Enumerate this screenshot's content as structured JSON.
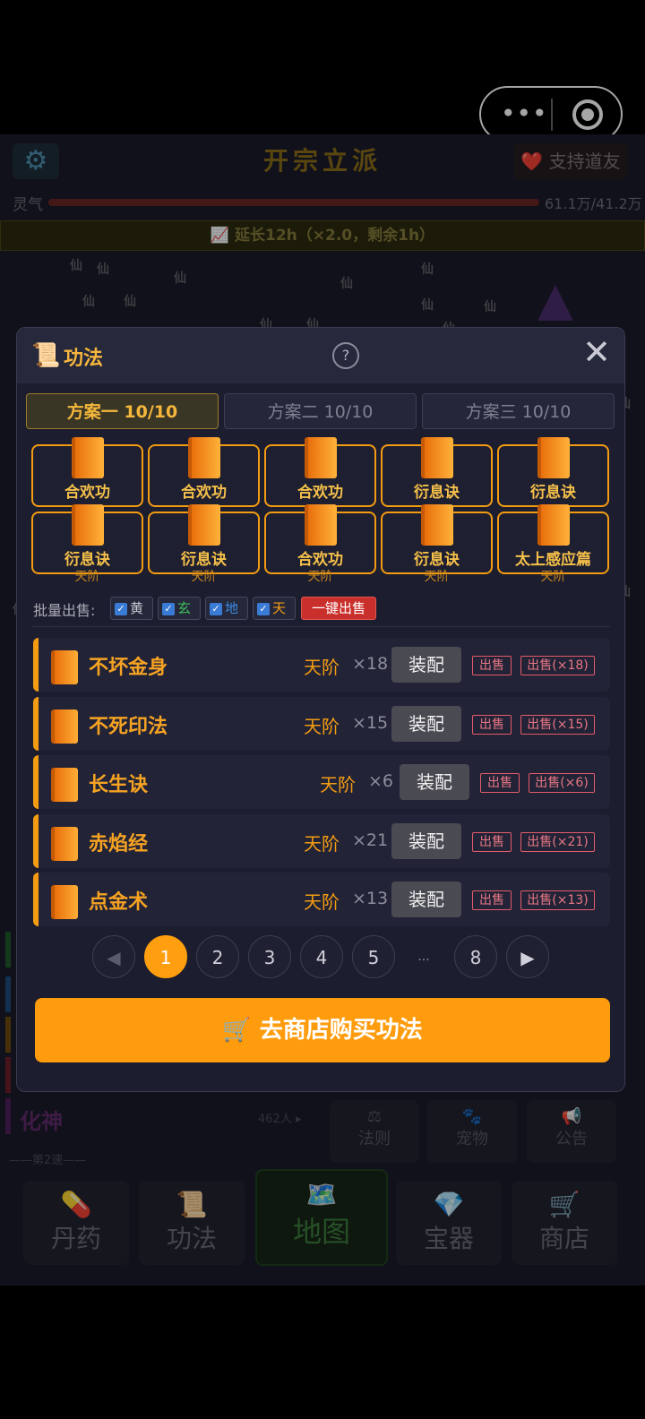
{
  "capsule": {
    "menu_icon": "more-dots-icon",
    "target_icon": "target-icon"
  },
  "game_header": {
    "settings_icon": "gear-icon",
    "title": "开宗立派",
    "support_label": "❤️ 支持道友",
    "qi_label": "灵气",
    "qi_value": "61.1万/41.2万",
    "extend_text": "📈 延长12h（×2.0，剩余1h）"
  },
  "background": {
    "xian_glyph": "仙",
    "huashen_label": "化神",
    "huashen_count": "462人 ▸",
    "second_label": "——第2速——",
    "side_buttons": [
      {
        "icon": "⚖",
        "label": "法则"
      },
      {
        "icon": "🐾",
        "label": "宠物"
      },
      {
        "icon": "📢",
        "label": "公告"
      }
    ],
    "bottom_nav": [
      {
        "icon": "💊",
        "label": "丹药"
      },
      {
        "icon": "📜",
        "label": "功法"
      },
      {
        "icon": "🗺️",
        "label": "地图"
      },
      {
        "icon": "💎",
        "label": "宝器"
      },
      {
        "icon": "🛒",
        "label": "商店"
      }
    ]
  },
  "modal": {
    "title_icon": "📜",
    "title": "功法",
    "help_label": "?",
    "close_label": "✕",
    "tabs": [
      {
        "label": "方案一 10/10",
        "active": true
      },
      {
        "label": "方案二 10/10",
        "active": false
      },
      {
        "label": "方案三 10/10",
        "active": false
      }
    ],
    "slots": [
      {
        "name": "合欢功",
        "grade": ""
      },
      {
        "name": "合欢功",
        "grade": ""
      },
      {
        "name": "合欢功",
        "grade": ""
      },
      {
        "name": "衍息诀",
        "grade": ""
      },
      {
        "name": "衍息诀",
        "grade": ""
      },
      {
        "name": "衍息诀",
        "grade": "天阶"
      },
      {
        "name": "衍息诀",
        "grade": "天阶"
      },
      {
        "name": "合欢功",
        "grade": "天阶"
      },
      {
        "name": "衍息诀",
        "grade": "天阶"
      },
      {
        "name": "太上感应篇",
        "grade": "天阶"
      }
    ],
    "bulk_sell": {
      "label": "批量出售:",
      "filters": [
        {
          "label": "黄",
          "color": "#c9c9d4",
          "checked": true
        },
        {
          "label": "玄",
          "color": "#3fbf5a",
          "checked": true
        },
        {
          "label": "地",
          "color": "#3a8fe8",
          "checked": true
        },
        {
          "label": "天",
          "color": "#f39c12",
          "checked": true
        }
      ],
      "sell_all_label": "一键出售"
    },
    "techniques": [
      {
        "name": "不坏金身",
        "grade": "天阶",
        "count": "×18",
        "equip": "装配",
        "sell": "出售",
        "sell_all": "出售(×18)"
      },
      {
        "name": "不死印法",
        "grade": "天阶",
        "count": "×15",
        "equip": "装配",
        "sell": "出售",
        "sell_all": "出售(×15)"
      },
      {
        "name": "长生诀",
        "grade": "天阶",
        "count": "×6",
        "equip": "装配",
        "sell": "出售",
        "sell_all": "出售(×6)"
      },
      {
        "name": "赤焰经",
        "grade": "天阶",
        "count": "×21",
        "equip": "装配",
        "sell": "出售",
        "sell_all": "出售(×21)"
      },
      {
        "name": "点金术",
        "grade": "天阶",
        "count": "×13",
        "equip": "装配",
        "sell": "出售",
        "sell_all": "出售(×13)"
      }
    ],
    "pagination": {
      "prev": "◀",
      "pages": [
        "1",
        "2",
        "3",
        "4",
        "5"
      ],
      "ellipsis": "...",
      "last": "8",
      "next": "▶",
      "current": "1"
    },
    "shop_button": "🛒 去商店购买功法"
  },
  "colors": {
    "accent": "#f39c12",
    "button_orange": "#ff9c0e",
    "modal_bg": "#1c1d2e"
  }
}
